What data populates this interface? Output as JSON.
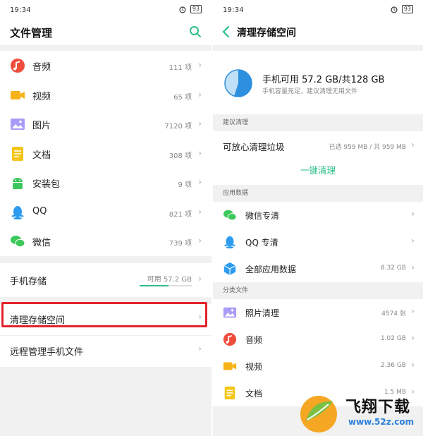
{
  "left": {
    "status": {
      "time": "19:34",
      "battery": "93"
    },
    "title": "文件管理",
    "categories": [
      {
        "label": "音频",
        "count": "111 项"
      },
      {
        "label": "视频",
        "count": "65 项"
      },
      {
        "label": "图片",
        "count": "7120 项"
      },
      {
        "label": "文档",
        "count": "308 项"
      },
      {
        "label": "安装包",
        "count": "9 项"
      },
      {
        "label": "QQ",
        "count": "821 项"
      },
      {
        "label": "微信",
        "count": "739 项"
      }
    ],
    "storage": {
      "label": "手机存储",
      "available": "可用 57.2 GB",
      "used_fraction": 0.55
    },
    "clean_label": "清理存储空间",
    "remote_label": "远程管理手机文件",
    "chevron": "›"
  },
  "right": {
    "status": {
      "time": "19:34",
      "battery": "93"
    },
    "title": "清理存储空间",
    "summary": {
      "main": "手机可用 57.2 GB/共128 GB",
      "sub": "手机容量充足，建议清理无用文件",
      "used_fraction": 0.55
    },
    "suggest_title": "建议清理",
    "junk": {
      "label": "可放心清理垃圾",
      "info": "已选 959 MB / 共 959 MB"
    },
    "onekey_label": "一键清理",
    "appdata_title": "应用数据",
    "apps": [
      {
        "label": "微信专清",
        "count": ""
      },
      {
        "label": "QQ 专清",
        "count": ""
      },
      {
        "label": "全部应用数据",
        "count": "8.32 GB"
      }
    ],
    "files_title": "分类文件",
    "files": [
      {
        "label": "照片清理",
        "count": "4574 张"
      },
      {
        "label": "音频",
        "count": "1.02 GB"
      },
      {
        "label": "视频",
        "count": "2.36 GB"
      },
      {
        "label": "文档",
        "count": "1.5 MB"
      }
    ]
  },
  "watermark": {
    "text": "飞翔下载",
    "url": "www.52z.com"
  },
  "colors": {
    "accent": "#2bbf86",
    "highlight": "#e3232b",
    "audio": "#ef4d3c",
    "video": "#f7b21a",
    "image": "#8b7cf6",
    "doc": "#f5c518",
    "apk": "#3ec75e",
    "qq": "#2d9cf0",
    "wechat": "#3cc85a"
  }
}
